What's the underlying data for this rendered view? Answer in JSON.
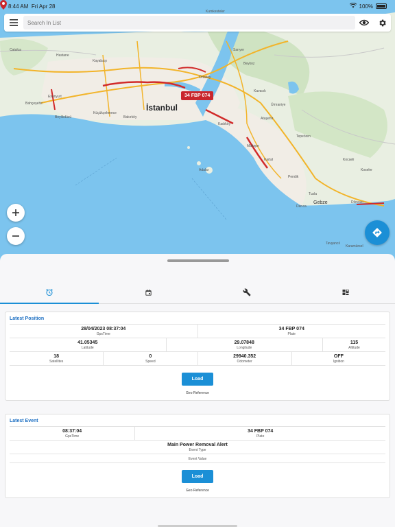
{
  "status_bar": {
    "time": "8:44 AM",
    "date": "Fri Apr 28",
    "battery": "100%"
  },
  "search": {
    "placeholder": "Search In List"
  },
  "map": {
    "city": "İstanbul",
    "vehicle_marker": "34 FBP 074",
    "labels": [
      "Kumkesteler",
      "Catalca",
      "Hastane",
      "Kayabaşı",
      "Beykoz",
      "Ortaköy",
      "Sarıyer",
      "Kavacık",
      "Ümraniye",
      "Ataşehir",
      "Kadıköy",
      "Pendik",
      "Adalar",
      "Tuzla",
      "Gebze",
      "Darıca",
      "Kartal",
      "Maltepe",
      "Bahçeşehir",
      "Esenyurt",
      "Beylikdüzü",
      "Küçükçekmece",
      "Bakırköy",
      "Dilovası",
      "Kocaeli",
      "Tepeören",
      "Karamürsel",
      "Tavşancıl",
      "Koseler"
    ]
  },
  "tabs": [
    {
      "name": "latest-position",
      "icon": "alarm-clock-icon",
      "active": true
    },
    {
      "name": "calendar",
      "icon": "calendar-icon",
      "active": false
    },
    {
      "name": "maintenance",
      "icon": "wrench-icon",
      "active": false
    },
    {
      "name": "map-view",
      "icon": "map-icon",
      "active": false
    }
  ],
  "latest_position": {
    "title": "Latest Position",
    "gps_time": {
      "value": "28/04/2023 08:37:04",
      "label": "GpsTime"
    },
    "plate": {
      "value": "34 FBP 074",
      "label": "Plate"
    },
    "latitude": {
      "value": "41.05345",
      "label": "Latitude"
    },
    "longitude": {
      "value": "29.07848",
      "label": "Longitude"
    },
    "altitude": {
      "value": "115",
      "label": "Altitude"
    },
    "satellites": {
      "value": "18",
      "label": "Satellites"
    },
    "speed": {
      "value": "0",
      "label": "Speed"
    },
    "odometer": {
      "value": "29940.352",
      "label": "Odometer"
    },
    "ignition": {
      "value": "OFF",
      "label": "Ignition"
    },
    "load_label": "Load",
    "geo_reference": "Geo Reference"
  },
  "latest_event": {
    "title": "Latest Event",
    "gps_time": {
      "value": "08:37:04",
      "label": "GpsTime"
    },
    "plate": {
      "value": "34 FBP 074",
      "label": "Plate"
    },
    "event_type": {
      "value": "Main Power Removal Alert",
      "label": "Event Type"
    },
    "event_value": {
      "label": "Event Value"
    },
    "load_label": "Load",
    "geo_reference": "Geo Reference"
  },
  "colors": {
    "accent": "#1b8fd6",
    "marker": "#c9262c",
    "sea": "#7cc4ee",
    "land": "#e9efe2"
  }
}
